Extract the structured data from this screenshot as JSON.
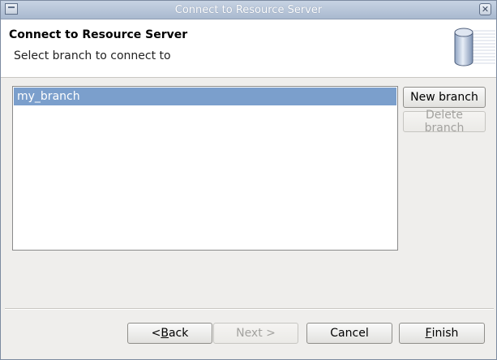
{
  "window": {
    "title": "Connect to Resource Server",
    "close_glyph": "✕"
  },
  "banner": {
    "title": "Connect to Resource Server",
    "subtitle": "Select branch to connect to",
    "icon": "database-icon"
  },
  "branches": {
    "items": [
      {
        "label": "my_branch",
        "selected": true
      }
    ],
    "new_label": "New branch",
    "delete_label": "Delete branch"
  },
  "footer": {
    "back_prefix": "< ",
    "back_mnemonic": "B",
    "back_rest": "ack",
    "next_label": "Next >",
    "cancel_label": "Cancel",
    "finish_mnemonic": "F",
    "finish_rest": "inish"
  },
  "colors": {
    "selection": "#7b9fcc",
    "titlebar": "#b5c3d8"
  }
}
